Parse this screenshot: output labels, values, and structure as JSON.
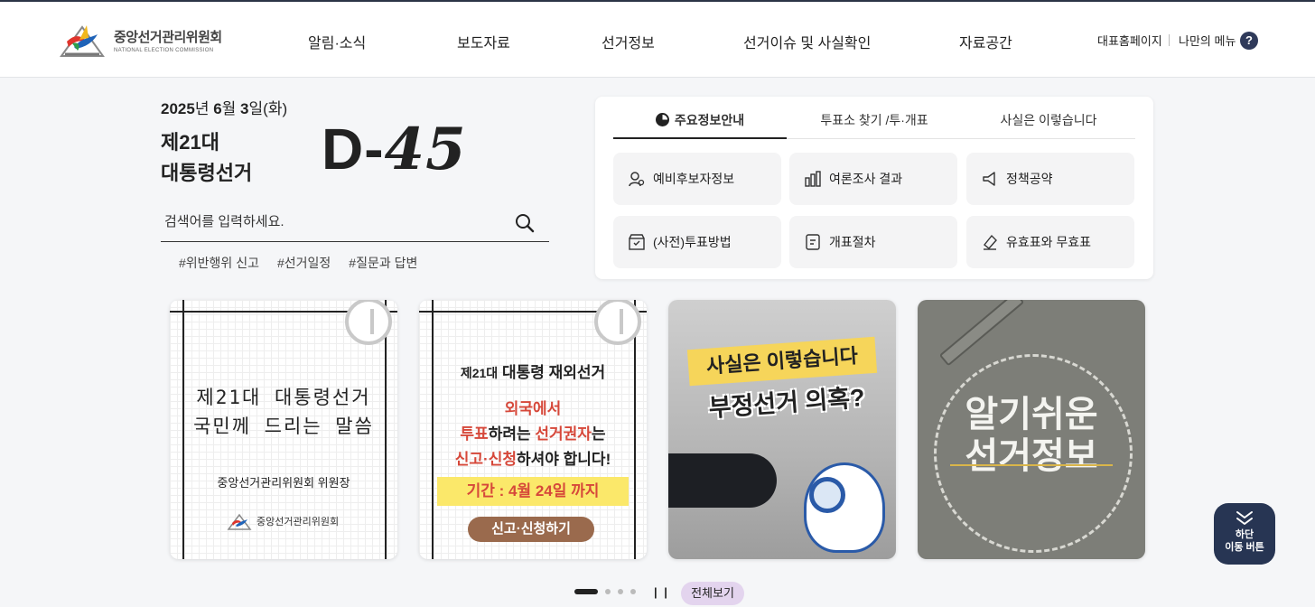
{
  "header": {
    "logo": {
      "name_ko": "중앙선거관리위원회",
      "name_en": "NATIONAL ELECTION COMMISSION"
    },
    "nav": [
      "알림·소식",
      "보도자료",
      "선거정보",
      "선거이슈 및 사실확인",
      "자료공간"
    ],
    "util": {
      "home": "대표홈페이지",
      "my_menu": "나만의 메뉴",
      "help": "?"
    }
  },
  "hero": {
    "date_year": "2025",
    "date_year_unit": "년",
    "date_month": "6",
    "date_month_unit": "월",
    "date_day": "3",
    "date_day_unit": "일",
    "date_weekday": "(화)",
    "election_line1": "제21대",
    "election_line2": "대통령선거",
    "dday_prefix": "D-",
    "dday_number": "45"
  },
  "search": {
    "placeholder": "검색어를 입력하세요.",
    "value": ""
  },
  "tags": [
    "#위반행위 신고",
    "#선거일정",
    "#질문과 답변"
  ],
  "panel": {
    "tabs": [
      "주요정보안내",
      "투표소 찾기 /투·개표",
      "사실은 이렇습니다"
    ],
    "active_tab": 0,
    "cards": [
      "예비후보자정보",
      "여론조사 결과",
      "정책공약",
      "(사전)투표방법",
      "개표절차",
      "유효표와 무효표"
    ]
  },
  "banners": {
    "b1": {
      "line1": "제21대 대통령선거",
      "line2": "국민께 드리는 말씀",
      "signature": "중앙선거관리위원회 위원장",
      "org": "중앙선거관리위원회"
    },
    "b2": {
      "heading_small": "제21대",
      "heading_big": "대통령 재외선거",
      "line1": "외국에서",
      "line2_a": "투표",
      "line2_b": "하려는 ",
      "line2_c": "선거권자",
      "line2_d": "는",
      "line3_a": "신고·신청",
      "line3_b": "하셔야 합니다!",
      "period": "기간 : 4월 24일 까지",
      "button": "신고·신청하기"
    },
    "b3": {
      "ribbon": "사실은 이렇습니다",
      "title": "부정선거 의혹?"
    },
    "b4": {
      "line1": "알기쉬운",
      "line2": "선거정보"
    }
  },
  "carousel": {
    "page_count": 4,
    "current_page": 1,
    "pause": "| |",
    "view_all": "전체보기"
  },
  "floating": {
    "line1": "하단",
    "line2": "이동 버튼"
  }
}
